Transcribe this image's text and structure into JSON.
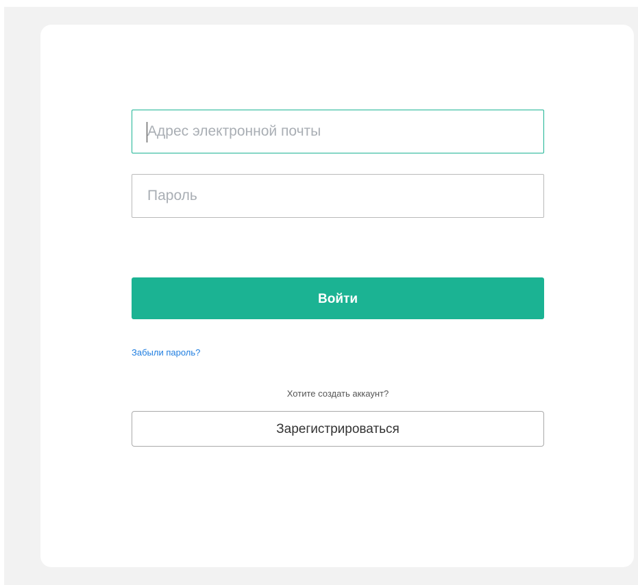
{
  "login_form": {
    "email_placeholder": "Адрес электронной почты",
    "email_value": "",
    "password_placeholder": "Пароль",
    "password_value": "",
    "login_button_label": "Войти",
    "forgot_password_link": "Забыли пароль?",
    "create_account_prompt": "Хотите создать аккаунт?",
    "register_button_label": "Зарегистрироваться"
  },
  "colors": {
    "accent": "#1bb393",
    "link": "#1e7de0",
    "page_background": "#f2f2f2",
    "card_background": "#ffffff"
  }
}
